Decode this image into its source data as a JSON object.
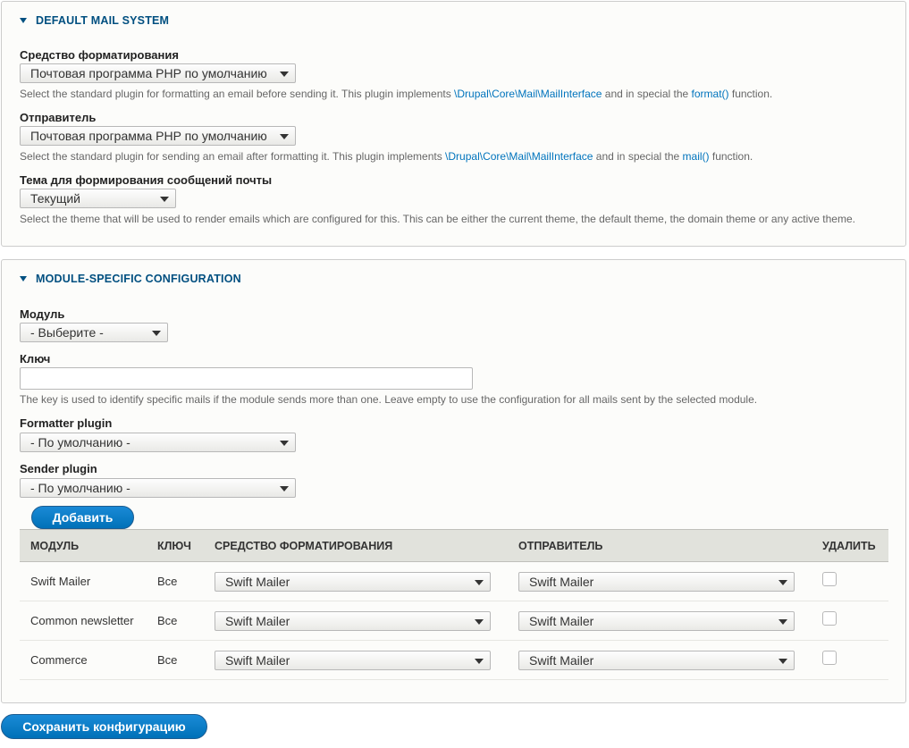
{
  "default_mail": {
    "legend": "Default mail system",
    "formatter": {
      "label": "Средство форматирования",
      "value": "Почтовая программа PHP по умолчанию",
      "desc_before": "Select the standard plugin for formatting an email before sending it. This plugin implements ",
      "desc_link1": "\\Drupal\\Core\\Mail\\MailInterface",
      "desc_mid": " and in special the ",
      "desc_link2": "format()",
      "desc_after": " function."
    },
    "sender": {
      "label": "Отправитель",
      "value": "Почтовая программа PHP по умолчанию",
      "desc_before": "Select the standard plugin for sending an email after formatting it. This plugin implements ",
      "desc_link1": "\\Drupal\\Core\\Mail\\MailInterface",
      "desc_mid": " and in special the ",
      "desc_link2": "mail()",
      "desc_after": " function."
    },
    "theme": {
      "label": "Тема для формирования сообщений почты",
      "value": "Текущий",
      "desc": "Select the theme that will be used to render emails which are configured for this. This can be either the current theme, the default theme, the domain theme or any active theme."
    }
  },
  "module_config": {
    "legend": "Module-specific configuration",
    "module": {
      "label": "Модуль",
      "value": "- Выберите -"
    },
    "key": {
      "label": "Ключ",
      "value": "",
      "desc": "The key is used to identify specific mails if the module sends more than one. Leave empty to use the configuration for all mails sent by the selected module."
    },
    "formatter_plugin": {
      "label": "Formatter plugin",
      "value": "- По умолчанию -"
    },
    "sender_plugin": {
      "label": "Sender plugin",
      "value": "- По умолчанию -"
    },
    "add_button": "Добавить",
    "table": {
      "headers": [
        "Модуль",
        "Ключ",
        "Средство форматирования",
        "Отправитель",
        "Удалить"
      ],
      "rows": [
        {
          "module": "Swift Mailer",
          "key": "Все",
          "formatter": "Swift Mailer",
          "sender": "Swift Mailer",
          "delete": false
        },
        {
          "module": "Common newsletter",
          "key": "Все",
          "formatter": "Swift Mailer",
          "sender": "Swift Mailer",
          "delete": false
        },
        {
          "module": "Commerce",
          "key": "Все",
          "formatter": "Swift Mailer",
          "sender": "Swift Mailer",
          "delete": false
        }
      ]
    }
  },
  "save_button": "Сохранить конфигурацию",
  "colors": {
    "accent": "#0071b8",
    "legend": "#004f80",
    "link": "#0074bd"
  }
}
